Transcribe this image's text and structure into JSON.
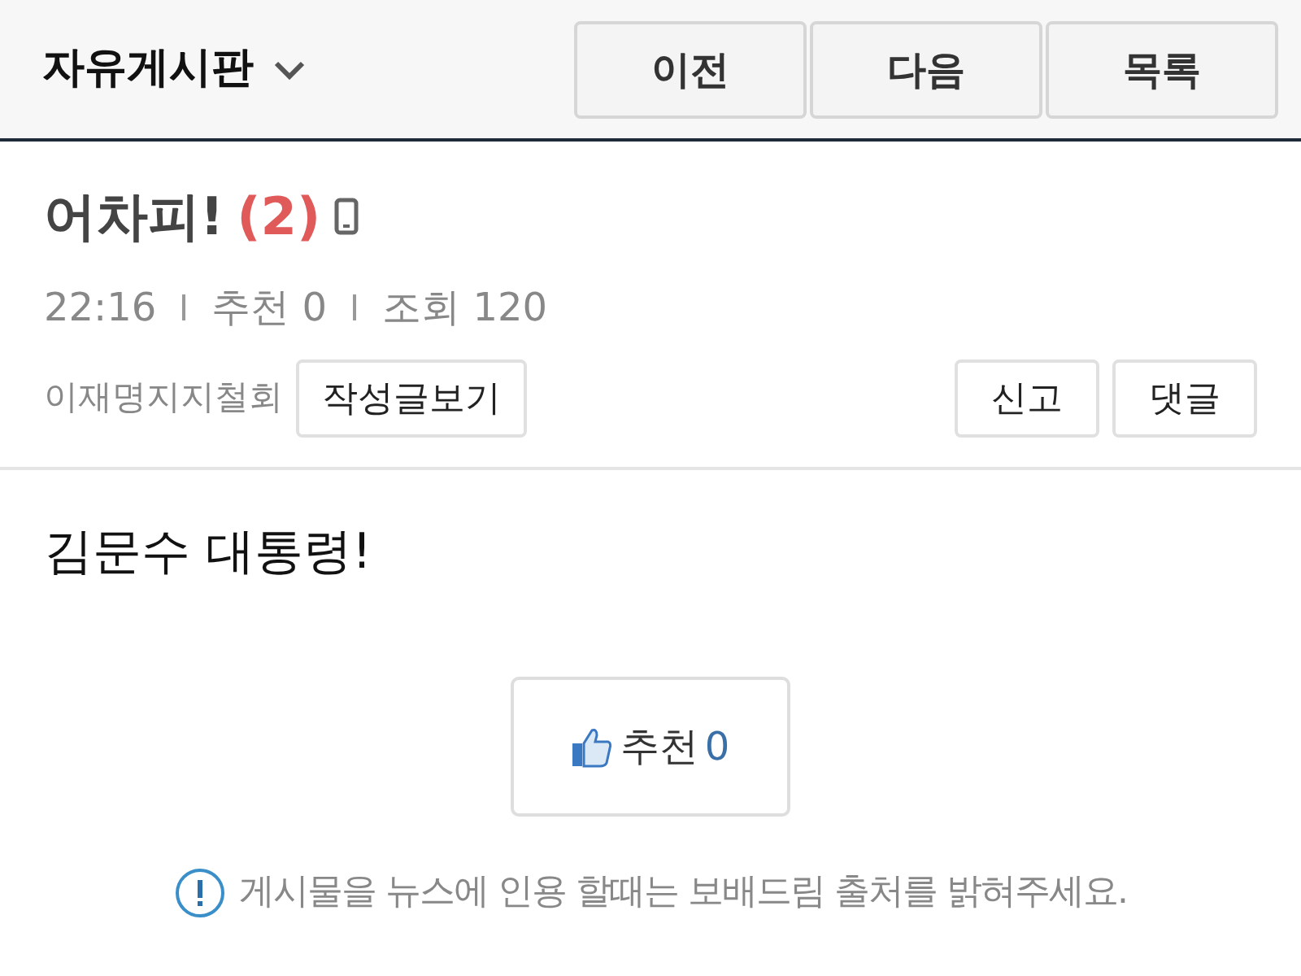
{
  "header": {
    "board_title": "자유게시판",
    "nav_buttons": [
      "이전",
      "다음",
      "목록"
    ]
  },
  "post": {
    "title": "어차피!",
    "comment_count": "(2)",
    "meta": [
      "22:16",
      "추천 0",
      "조회 120"
    ],
    "author": "이재명지지철회",
    "author_button": "작성글보기",
    "action_buttons": [
      "신고",
      "댓글"
    ],
    "body": "김문수 대통령!",
    "recommend": {
      "label": "추천",
      "count": "0"
    }
  },
  "notice": "게시물을 뉴스에 인용 할때는 보배드림 출처를 밝혀주세요."
}
